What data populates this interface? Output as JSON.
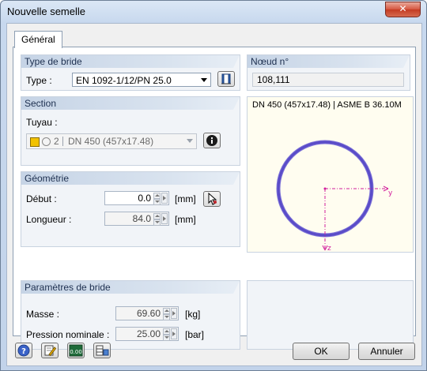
{
  "window": {
    "title": "Nouvelle semelle",
    "close_glyph": "✕"
  },
  "tabs": [
    {
      "label": "Général",
      "active": true
    }
  ],
  "flange_type": {
    "header": "Type de bride",
    "type_label": "Type :",
    "type_value": "EN 1092-1/12/PN 25.0",
    "library_icon": "library-book-icon"
  },
  "node": {
    "header": "Nœud n°",
    "value": "108,111"
  },
  "section": {
    "header": "Section",
    "pipe_label": "Tuyau :",
    "pipe_number": "2",
    "pipe_value": "DN 450 (457x17.48)",
    "info_icon": "info-icon"
  },
  "geometry": {
    "header": "Géométrie",
    "start_label": "Début :",
    "start_value": "0.0",
    "start_unit": "[mm]",
    "length_label": "Longueur :",
    "length_value": "84.0",
    "length_unit": "[mm]",
    "pick_icon": "pick-cursor-icon"
  },
  "flange_params": {
    "header": "Paramètres de bride",
    "mass_label": "Masse :",
    "mass_value": "69.60",
    "mass_unit": "[kg]",
    "pressure_label": "Pression nominale :",
    "pressure_value": "25.00",
    "pressure_unit": "[bar]"
  },
  "preview": {
    "title": "DN 450 (457x17.48) | ASME B 36.10M",
    "axis_y": "y",
    "axis_z": "z",
    "colors": {
      "ring": "#5a4cc8",
      "axes": "#d21e9c"
    }
  },
  "footer": {
    "ok_label": "OK",
    "cancel_label": "Annuler",
    "tools": [
      "help-icon",
      "edit-notes-icon",
      "units-icon",
      "settings-table-icon"
    ],
    "units_caption": "0.00"
  }
}
